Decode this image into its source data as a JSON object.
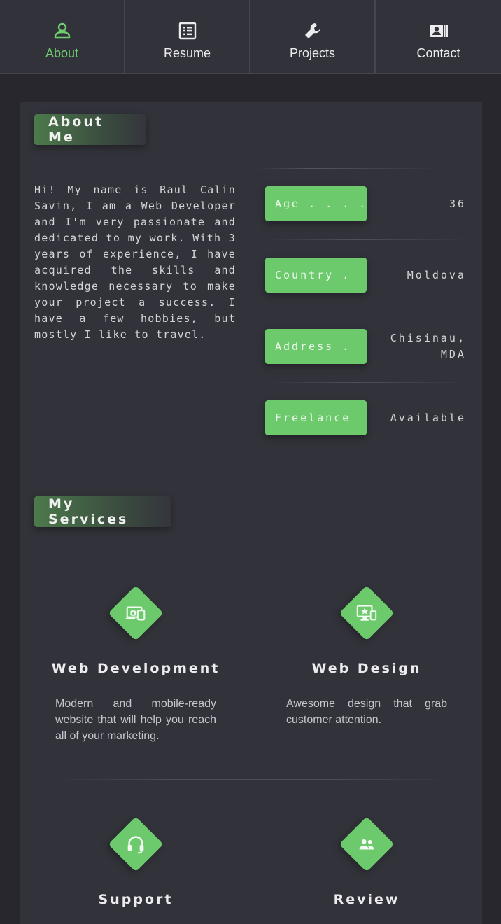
{
  "nav": {
    "items": [
      {
        "label": "About",
        "icon": "person-icon",
        "active": true
      },
      {
        "label": "Resume",
        "icon": "list-icon",
        "active": false
      },
      {
        "label": "Projects",
        "icon": "wrench-icon",
        "active": false
      },
      {
        "label": "Contact",
        "icon": "contact-card-icon",
        "active": false
      }
    ]
  },
  "about": {
    "heading": "About Me",
    "bio": "Hi! My name is Raul Calin Savin, I am a Web Developer and I'm very passionate and dedicated to my work. With 3 years of experience, I have acquired the skills and knowledge necessary to make your project a success. I have a few hobbies, but mostly I like to travel.",
    "info": [
      {
        "key": "Age . . . .",
        "value": "36"
      },
      {
        "key": "Country .",
        "value": "Moldova"
      },
      {
        "key": "Address .",
        "value": "Chisinau, MDA"
      },
      {
        "key": "Freelance",
        "value": "Available"
      }
    ]
  },
  "services": {
    "heading": "My Services",
    "items": [
      {
        "title": "Web Development",
        "desc": "Modern and mobile-ready website that will help you reach all of your marketing.",
        "icon": "devices-icon"
      },
      {
        "title": "Web Design",
        "desc": "Awesome design that grab customer attention.",
        "icon": "monitor-design-icon"
      },
      {
        "title": "Support",
        "desc": "",
        "icon": "headset-icon"
      },
      {
        "title": "Review",
        "desc": "",
        "icon": "people-icon"
      }
    ]
  },
  "colors": {
    "accent": "#6cc96c",
    "background": "#27272d",
    "card": "#32323a"
  }
}
